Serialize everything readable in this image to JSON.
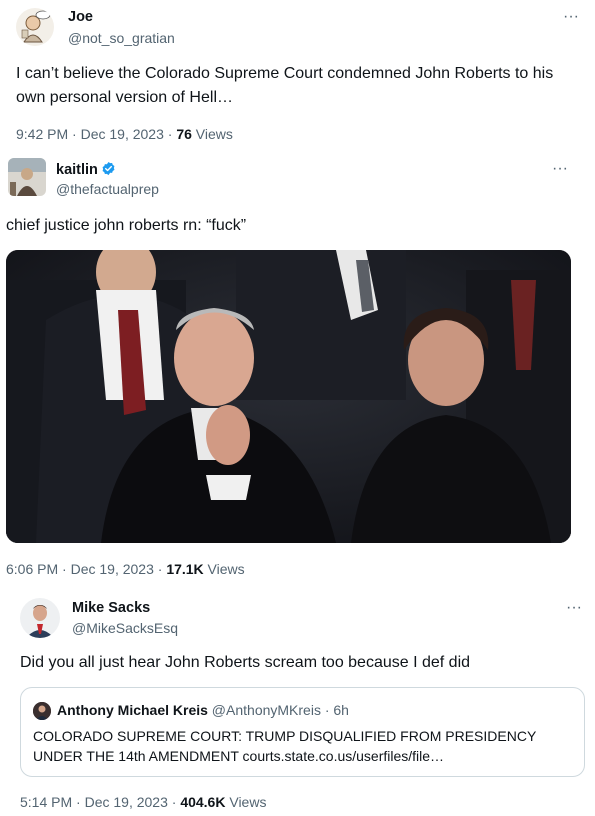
{
  "tweets": [
    {
      "name": "Joe",
      "handle": "@not_so_gratian",
      "text": "I can’t believe the Colorado Supreme Court condemned John Roberts to his own personal version of Hell…",
      "time": "9:42 PM · Dec 19, 2023 · ",
      "views_count": "76",
      "views_label": " Views",
      "more": "···"
    },
    {
      "name": "kaitlin",
      "verified": true,
      "handle": "@thefactualprep",
      "text": "chief justice john roberts rn: “fuck”",
      "time": "6:06 PM · Dec 19, 2023 · ",
      "views_count": "17.1K",
      "views_label": " Views",
      "more": "···"
    },
    {
      "name": "Mike Sacks",
      "handle": "@MikeSacksEsq",
      "text": "Did you all just hear John Roberts scream too because I def did",
      "time": "5:14 PM · Dec 19, 2023 · ",
      "views_count": "404.6K",
      "views_label": " Views",
      "more": "···",
      "quote": {
        "name": "Anthony Michael Kreis",
        "handle_time": " @AnthonyMKreis · 6h",
        "text": "COLORADO SUPREME COURT: TRUMP DISQUALIFIED FROM PRESIDENCY UNDER THE 14th AMENDMENT courts.state.co.us/userfiles/file…"
      }
    }
  ],
  "colors": {
    "text": "#0f1419",
    "secondary": "#536471",
    "verified": "#1d9bf0",
    "border": "#cfd9de"
  },
  "icons": [
    "more-icon",
    "verified-badge-icon"
  ]
}
